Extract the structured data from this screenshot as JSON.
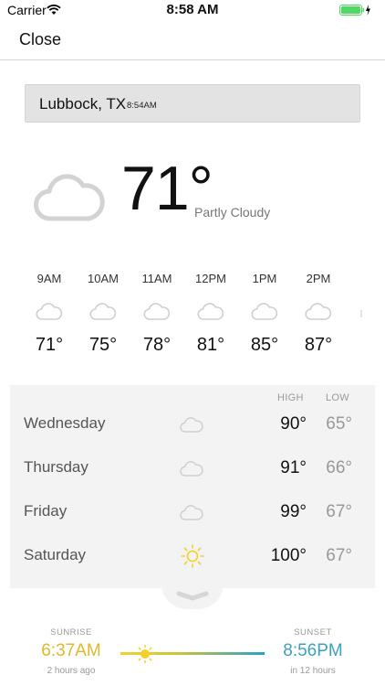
{
  "status_bar": {
    "carrier": "Carrier",
    "time": "8:58 AM",
    "battery_color": "#4cd964"
  },
  "nav": {
    "close_label": "Close"
  },
  "location": {
    "name": "Lubbock, TX",
    "time": "8:54AM"
  },
  "current": {
    "icon": "cloud-icon",
    "temperature": "71°",
    "condition": "Partly Cloudy"
  },
  "hourly": [
    {
      "time": "9AM",
      "icon": "cloud-icon",
      "temp": "71°"
    },
    {
      "time": "10AM",
      "icon": "cloud-icon",
      "temp": "75°"
    },
    {
      "time": "11AM",
      "icon": "cloud-icon",
      "temp": "78°"
    },
    {
      "time": "12PM",
      "icon": "cloud-icon",
      "temp": "81°"
    },
    {
      "time": "1PM",
      "icon": "cloud-icon",
      "temp": "85°"
    },
    {
      "time": "2PM",
      "icon": "cloud-icon",
      "temp": "87°"
    }
  ],
  "daily": {
    "high_header": "HIGH",
    "low_header": "LOW",
    "days": [
      {
        "name": "Wednesday",
        "icon": "cloud-icon",
        "high": "90°",
        "low": "65°"
      },
      {
        "name": "Thursday",
        "icon": "cloud-icon",
        "high": "91°",
        "low": "66°"
      },
      {
        "name": "Friday",
        "icon": "cloud-icon",
        "high": "99°",
        "low": "67°"
      },
      {
        "name": "Saturday",
        "icon": "sun-icon",
        "high": "100°",
        "low": "67°"
      }
    ]
  },
  "sun": {
    "sunrise_label": "SUNRISE",
    "sunrise_time": "6:37AM",
    "sunrise_relative": "2 hours ago",
    "sunset_label": "SUNSET",
    "sunset_time": "8:56PM",
    "sunset_relative": "in 12 hours",
    "sunrise_color": "#e0b92a",
    "sunset_color": "#3f9fc2",
    "sun_color": "#f4cf2a"
  }
}
